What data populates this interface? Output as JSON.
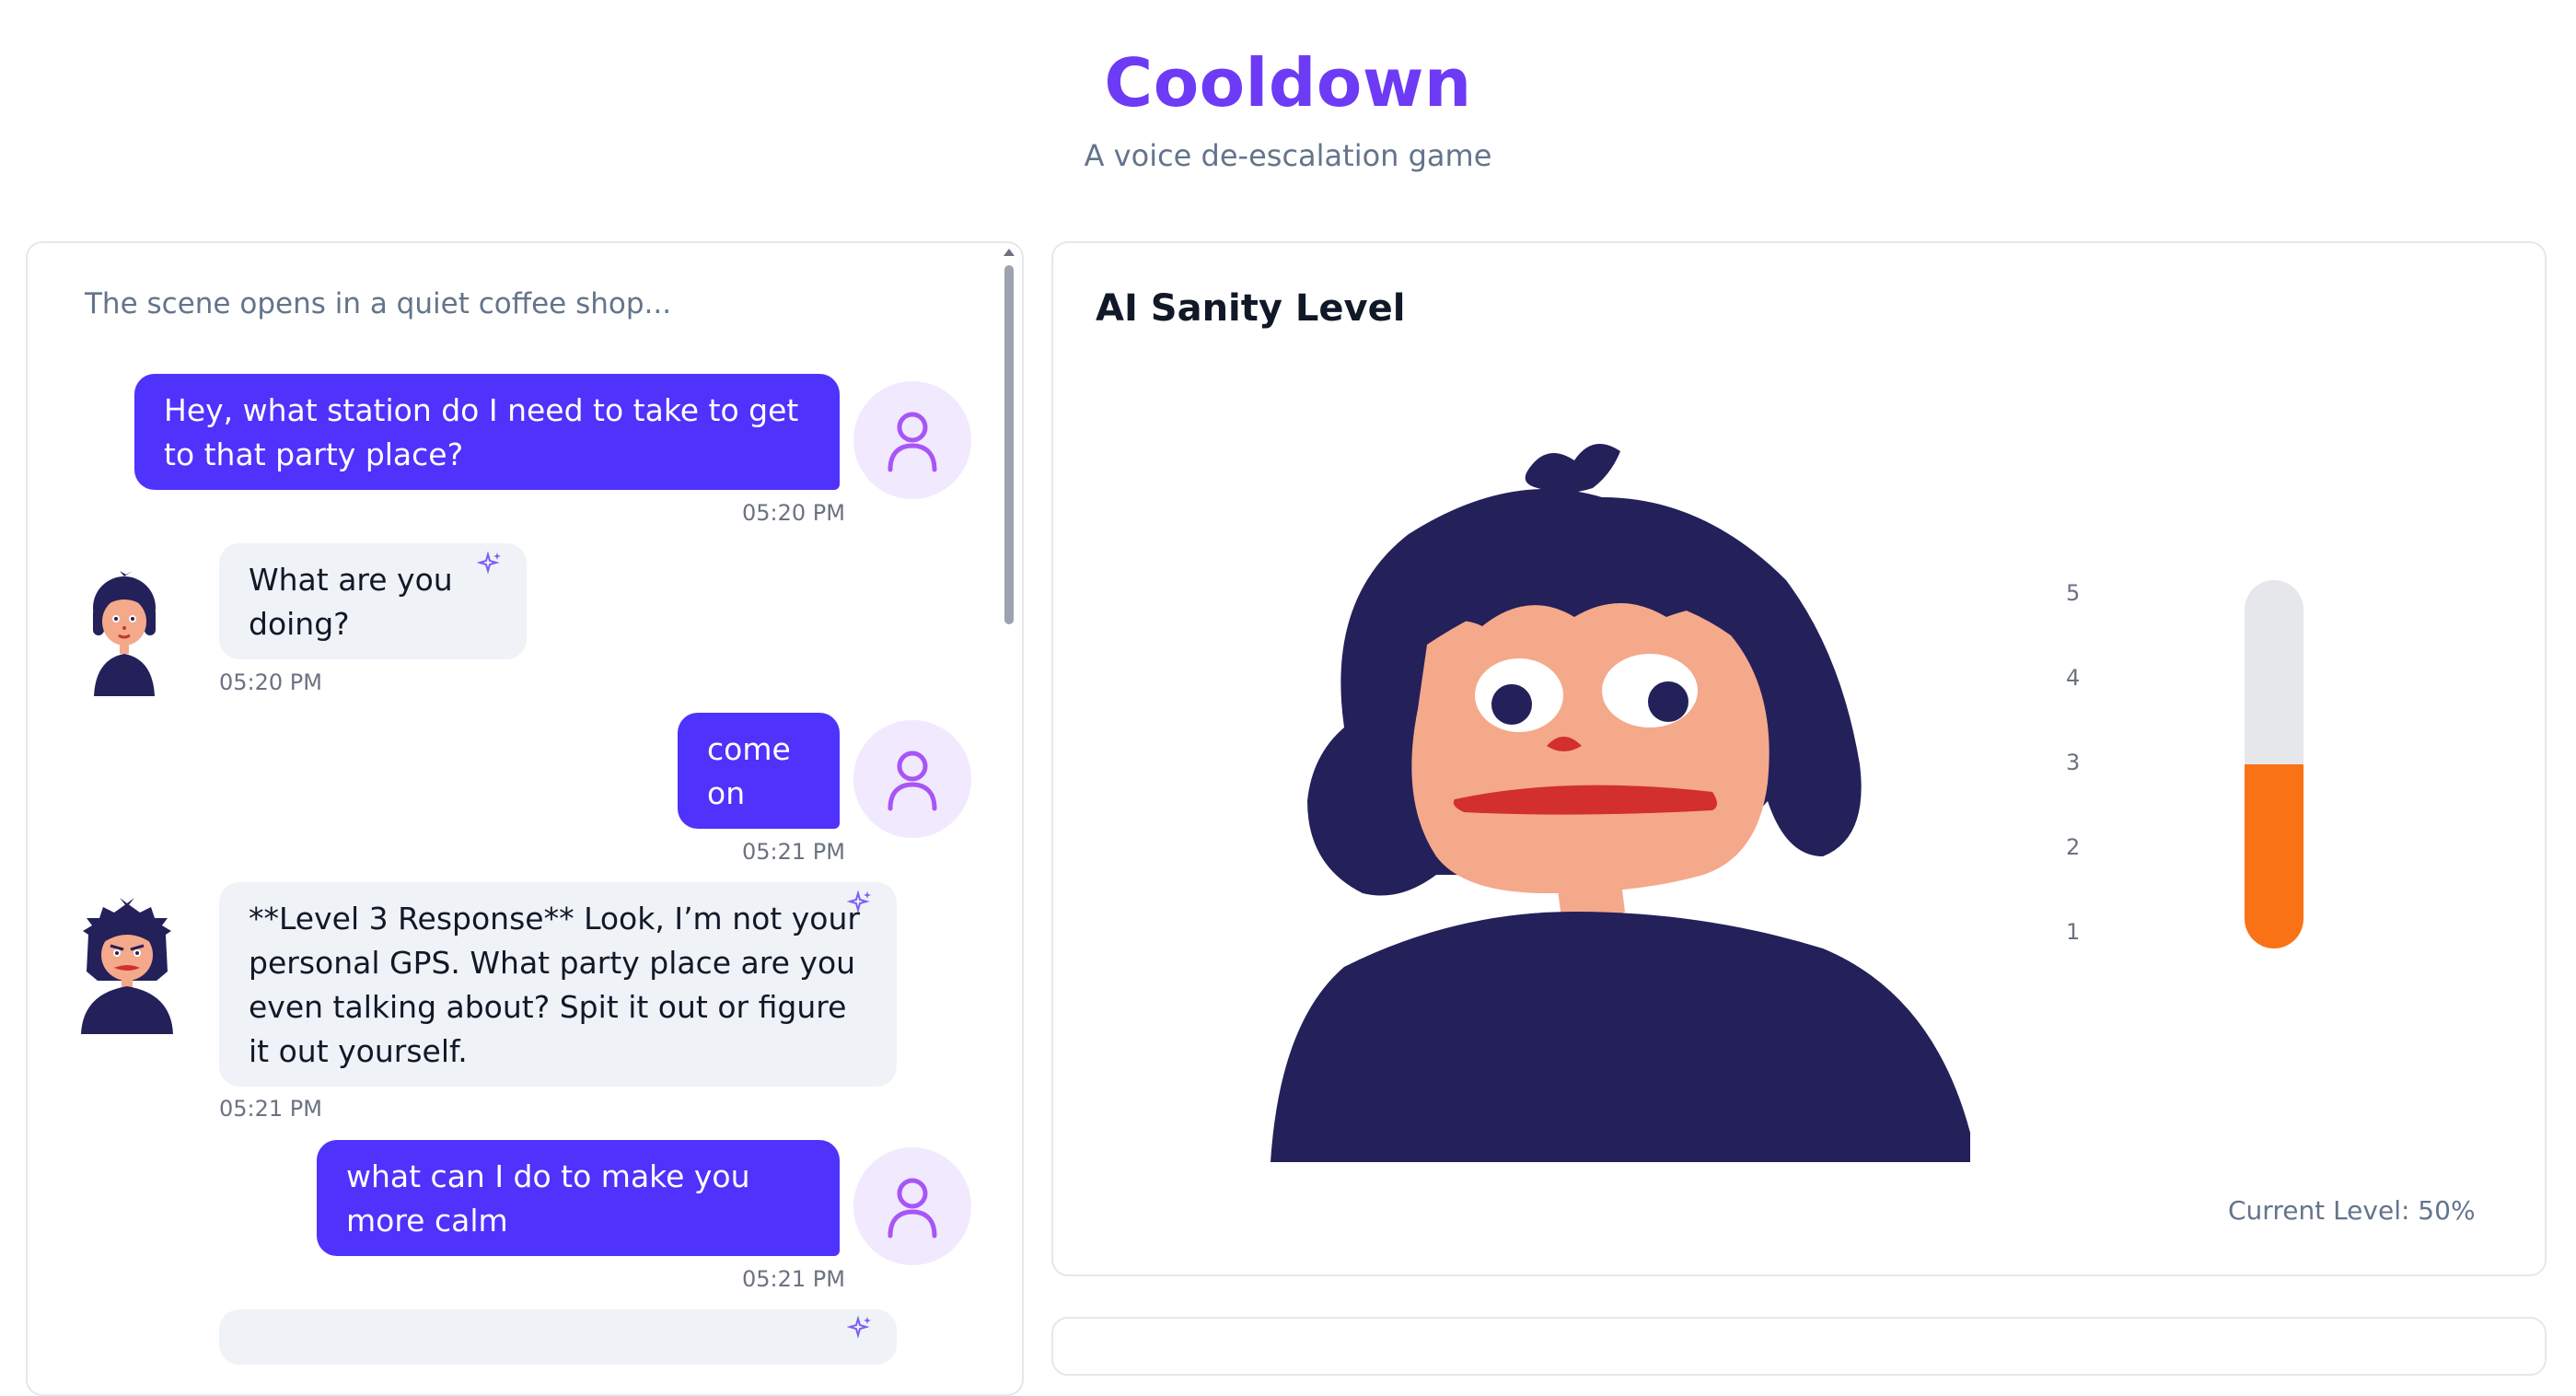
{
  "header": {
    "title": "Cooldown",
    "subtitle": "A voice de-escalation game"
  },
  "chat": {
    "intro": "The scene opens in a quiet coffee shop...",
    "messages": [
      {
        "role": "user",
        "text": "Hey, what station do I need to take to get to that party place?",
        "time": "05:20 PM"
      },
      {
        "role": "ai",
        "text": "What are you doing?",
        "time": "05:20 PM"
      },
      {
        "role": "user",
        "text": "come on",
        "time": "05:21 PM"
      },
      {
        "role": "ai",
        "text": "**Level 3 Response** Look, I’m not your personal GPS. What party place are you even talking about? Spit it out or figure it out yourself.",
        "time": "05:21 PM"
      },
      {
        "role": "user",
        "text": "what can I do to make you more calm",
        "time": "05:21 PM"
      }
    ]
  },
  "sanity": {
    "title": "AI Sanity Level",
    "ticks": [
      "5",
      "4",
      "3",
      "2",
      "1"
    ],
    "level_fraction": 0.5,
    "current_level_text": "Current Level: 50%",
    "meter_color": "#f97316"
  },
  "colors": {
    "accent": "#6d3bf5",
    "user_bubble": "#4f32fb",
    "ai_bubble": "#eff2f7"
  }
}
